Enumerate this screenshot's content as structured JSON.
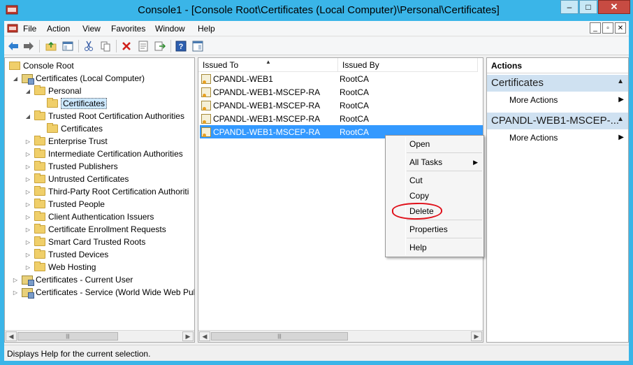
{
  "window": {
    "title": "Console1 - [Console Root\\Certificates (Local Computer)\\Personal\\Certificates]",
    "minimize": "–",
    "maximize": "□",
    "close": "✕"
  },
  "menu": [
    "File",
    "Action",
    "View",
    "Favorites",
    "Window",
    "Help"
  ],
  "tree": {
    "root": "Console Root",
    "local_computer": "Certificates (Local Computer)",
    "personal": "Personal",
    "personal_certs": "Certificates",
    "trusted_root": "Trusted Root Certification Authorities",
    "trusted_root_certs": "Certificates",
    "stores": [
      "Enterprise Trust",
      "Intermediate Certification Authorities",
      "Trusted Publishers",
      "Untrusted Certificates",
      "Third-Party Root Certification Authoriti",
      "Trusted People",
      "Client Authentication Issuers",
      "Certificate Enrollment Requests",
      "Smart Card Trusted Roots",
      "Trusted Devices",
      "Web Hosting"
    ],
    "current_user": "Certificates - Current User",
    "service": "Certificates - Service (World Wide Web Pub"
  },
  "list": {
    "columns": [
      "Issued To",
      "Issued By"
    ],
    "rows": [
      {
        "issued_to": "CPANDL-WEB1",
        "issued_by": "RootCA"
      },
      {
        "issued_to": "CPANDL-WEB1-MSCEP-RA",
        "issued_by": "RootCA"
      },
      {
        "issued_to": "CPANDL-WEB1-MSCEP-RA",
        "issued_by": "RootCA"
      },
      {
        "issued_to": "CPANDL-WEB1-MSCEP-RA",
        "issued_by": "RootCA"
      },
      {
        "issued_to": "CPANDL-WEB1-MSCEP-RA",
        "issued_by": "RootCA"
      }
    ],
    "selected_index": 4
  },
  "actions": {
    "header": "Actions",
    "section1": "Certificates",
    "section1_item": "More Actions",
    "section2": "CPANDL-WEB1-MSCEP-...",
    "section2_item": "More Actions"
  },
  "context_menu": {
    "open": "Open",
    "all_tasks": "All Tasks",
    "cut": "Cut",
    "copy": "Copy",
    "delete": "Delete",
    "properties": "Properties",
    "help": "Help"
  },
  "status": "Displays Help for the current selection.",
  "colors": {
    "title_bar": "#3ab5e8",
    "selection": "#3399ff",
    "action_section": "#cfe1f1",
    "annotation": "#e0101a"
  }
}
